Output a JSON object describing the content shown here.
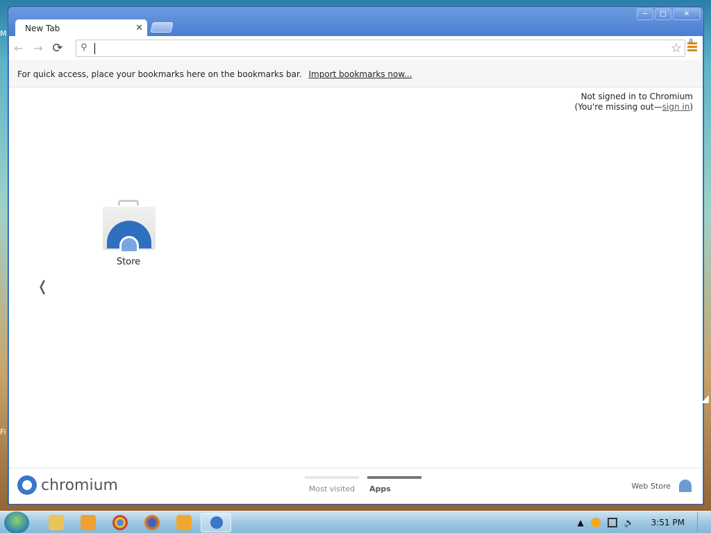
{
  "desktop": {
    "left_label_top": "M",
    "left_label_bottom": "Fi"
  },
  "window": {
    "controls": [
      "▭",
      "□",
      "✕"
    ]
  },
  "tab": {
    "title": "New Tab",
    "close": "✕"
  },
  "toolbar": {
    "back": "←",
    "forward": "→",
    "reload": "⟳",
    "omnibox_value": "",
    "star": "☆",
    "menu_badge": "a"
  },
  "bookmarks_bar": {
    "message": "For quick access, place your bookmarks here on the bookmarks bar.",
    "import_link": "Import bookmarks now..."
  },
  "signin": {
    "line1": "Not signed in to Chromium",
    "line2_prefix": "(You're missing out—",
    "link": "sign in",
    "line2_suffix": ")"
  },
  "apps": [
    {
      "label": "Store"
    }
  ],
  "nav_arrow": "❬",
  "footer": {
    "brand": "chromium",
    "tabs": [
      {
        "label": "Most visited",
        "active": false
      },
      {
        "label": "Apps",
        "active": true
      }
    ],
    "web_store": "Web Store"
  },
  "taskbar": {
    "clock": "3:51 PM"
  },
  "colors": {
    "titlebar": "#4b7ed2",
    "accent": "#2f6fbf",
    "menu": "#d88a1c"
  }
}
